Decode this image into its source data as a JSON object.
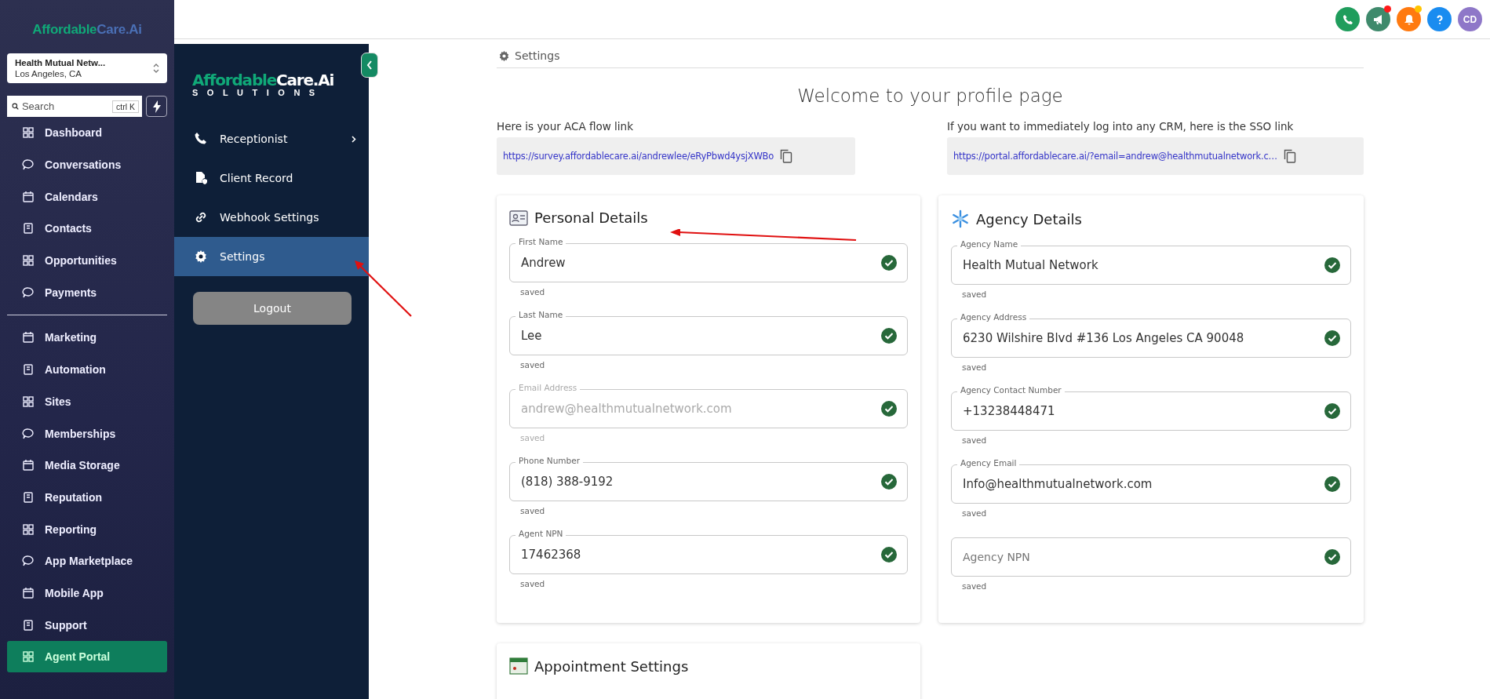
{
  "sidebar": {
    "logo": {
      "lead": "Affordable",
      "rest": "Care.Ai"
    },
    "account": {
      "name": "Health Mutual Netw...",
      "location": "Los Angeles, CA"
    },
    "search": {
      "placeholder": "Search",
      "shortcut": "ctrl K"
    },
    "items": [
      {
        "label": "Dashboard",
        "selected": false
      },
      {
        "label": "Conversations",
        "selected": false
      },
      {
        "label": "Calendars",
        "selected": false
      },
      {
        "label": "Contacts",
        "selected": false
      },
      {
        "label": "Opportunities",
        "selected": false
      },
      {
        "label": "Payments",
        "selected": false
      },
      {
        "label": "Marketing",
        "selected": false
      },
      {
        "label": "Automation",
        "selected": false
      },
      {
        "label": "Sites",
        "selected": false
      },
      {
        "label": "Memberships",
        "selected": false
      },
      {
        "label": "Media Storage",
        "selected": false
      },
      {
        "label": "Reputation",
        "selected": false
      },
      {
        "label": "Reporting",
        "selected": false
      },
      {
        "label": "App Marketplace",
        "selected": false
      },
      {
        "label": "Mobile App",
        "selected": false
      },
      {
        "label": "Support",
        "selected": false
      },
      {
        "label": "Agent Portal",
        "selected": true
      }
    ]
  },
  "header": {
    "buttons": [
      {
        "kind": "phone",
        "badge": false
      },
      {
        "kind": "megaphone",
        "badge": true
      },
      {
        "kind": "bell",
        "badge": true
      },
      {
        "kind": "help",
        "badge": false
      }
    ],
    "avatar": "CD"
  },
  "portal_menu": {
    "logo": {
      "lead": "Affordable",
      "rest": "Care.Ai",
      "sub": "SOLUTIONS"
    },
    "items": [
      {
        "label": "Receptionist",
        "expandable": true,
        "selected": false
      },
      {
        "label": "Client Record",
        "expandable": false,
        "selected": false
      },
      {
        "label": "Webhook Settings",
        "expandable": false,
        "selected": false
      },
      {
        "label": "Settings",
        "expandable": false,
        "selected": true
      }
    ],
    "logout": "Logout"
  },
  "page": {
    "breadcrumb": "Settings",
    "title": "Welcome to your profile page",
    "links": [
      {
        "label": "Here is your ACA flow link",
        "url": "https://survey.affordablecare.ai/andrewlee/eRyPbwd4ysjXWBo"
      },
      {
        "label": "If you want to immediately log into any CRM, here is the SSO link",
        "url": "https://portal.affordablecare.ai/?email=andrew@healthmutualnetwork.c…"
      }
    ],
    "cards": [
      {
        "title": "Personal Details",
        "kind": "person",
        "fields": [
          {
            "label": "First Name",
            "value": "Andrew",
            "disabled": false,
            "verified": true,
            "helper": "saved"
          },
          {
            "label": "Last Name",
            "value": "Lee",
            "disabled": false,
            "verified": true,
            "helper": "saved"
          },
          {
            "label": "Email Address",
            "value": "andrew@healthmutualnetwork.com",
            "disabled": true,
            "verified": true,
            "helper": "saved"
          },
          {
            "label": "Phone Number",
            "value": "(818) 388-9192",
            "disabled": false,
            "verified": true,
            "helper": "saved"
          },
          {
            "label": "Agent NPN",
            "value": "17462368",
            "disabled": false,
            "verified": true,
            "helper": "saved"
          }
        ]
      },
      {
        "title": "Agency Details",
        "kind": "agency",
        "fields": [
          {
            "label": "Agency Name",
            "value": "Health Mutual Network",
            "disabled": false,
            "verified": true,
            "helper": "saved"
          },
          {
            "label": "Agency Address",
            "value": "6230 Wilshire Blvd #136 Los Angeles CA 90048",
            "disabled": false,
            "verified": true,
            "helper": "saved"
          },
          {
            "label": "Agency Contact Number",
            "value": "+13238448471",
            "disabled": false,
            "verified": true,
            "helper": "saved"
          },
          {
            "label": "Agency Email",
            "value": "Info@healthmutualnetwork.com",
            "disabled": false,
            "verified": true,
            "helper": "saved"
          },
          {
            "placeholder": "Agency NPN",
            "disabled": false,
            "verified": true,
            "helper": "saved"
          }
        ]
      }
    ],
    "next_section": {
      "title": "Appointment Settings"
    }
  }
}
